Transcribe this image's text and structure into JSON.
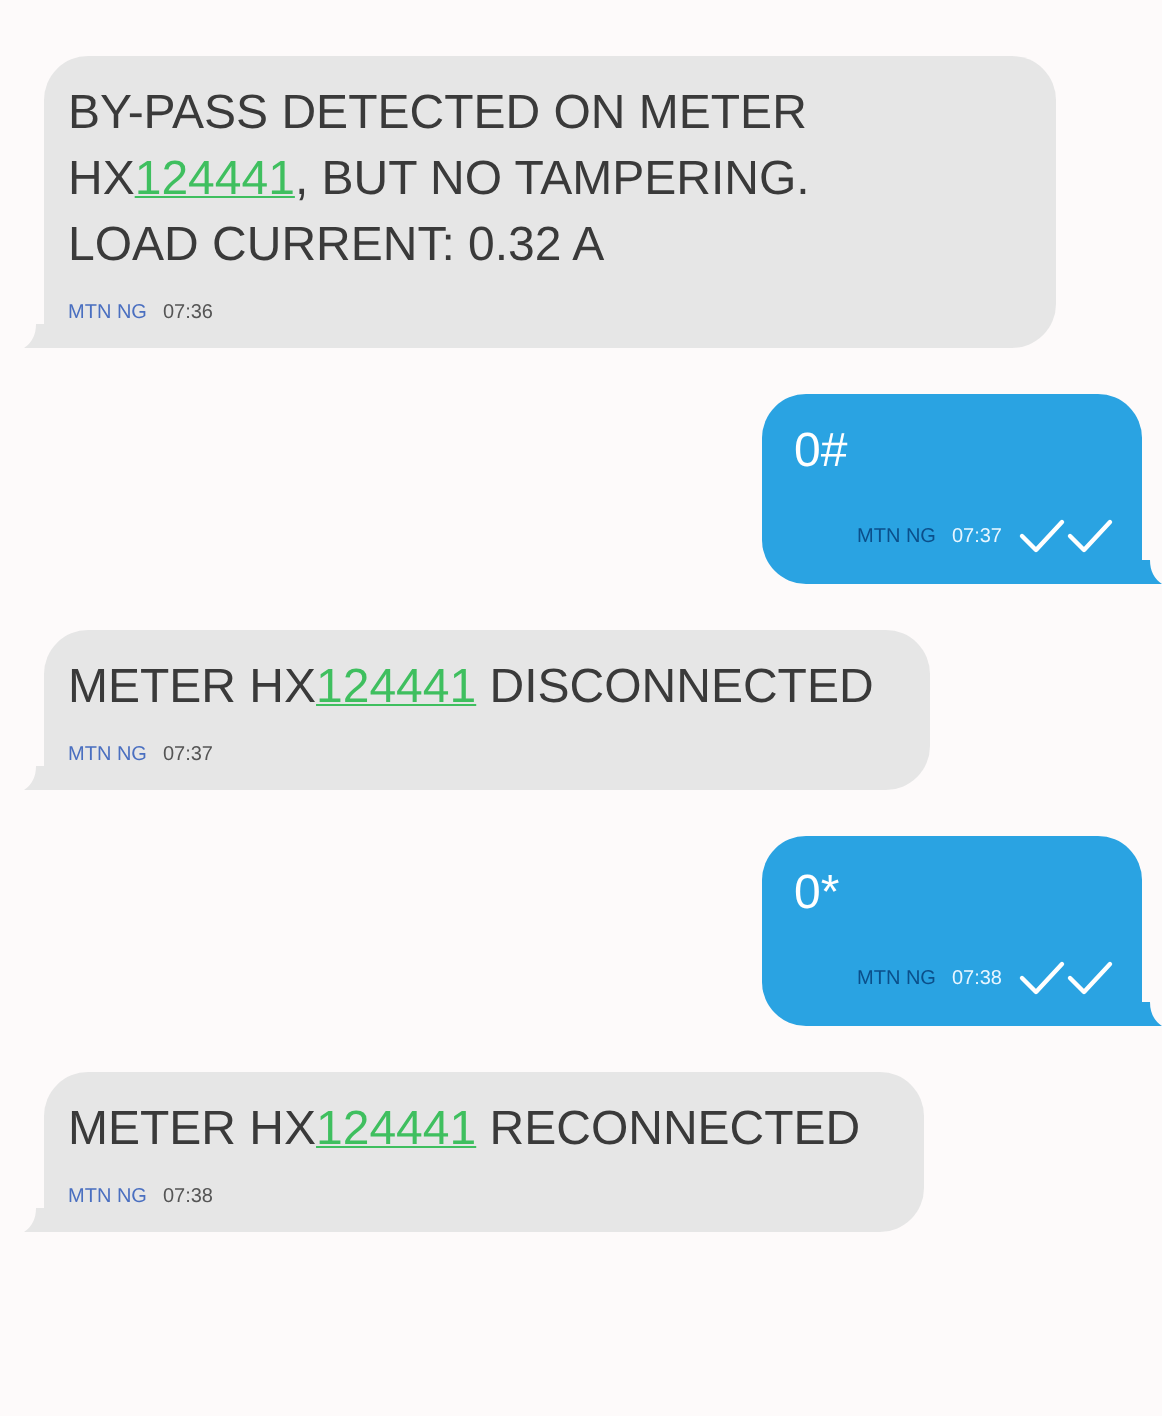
{
  "messages": [
    {
      "kind": "received",
      "text_before": "BY-PASS DETECTED ON METER HX",
      "link": "124441",
      "text_after": ", BUT NO TAMPERING. LOAD CURRENT: 0.32 A",
      "sender": "MTN NG",
      "time": "07:36"
    },
    {
      "kind": "sent",
      "text_before": "0#",
      "sender": "MTN NG",
      "time": "07:37",
      "delivered": true
    },
    {
      "kind": "received",
      "text_before": "METER HX",
      "link": "124441",
      "text_after": " DISCONNECTED",
      "sender": "MTN NG",
      "time": "07:37"
    },
    {
      "kind": "sent",
      "text_before": "0*",
      "sender": "MTN NG",
      "time": "07:38",
      "delivered": true
    },
    {
      "kind": "received",
      "text_before": "METER HX",
      "link": "124441",
      "text_after": " RECONNECTED",
      "sender": "MTN NG",
      "time": "07:38"
    }
  ]
}
